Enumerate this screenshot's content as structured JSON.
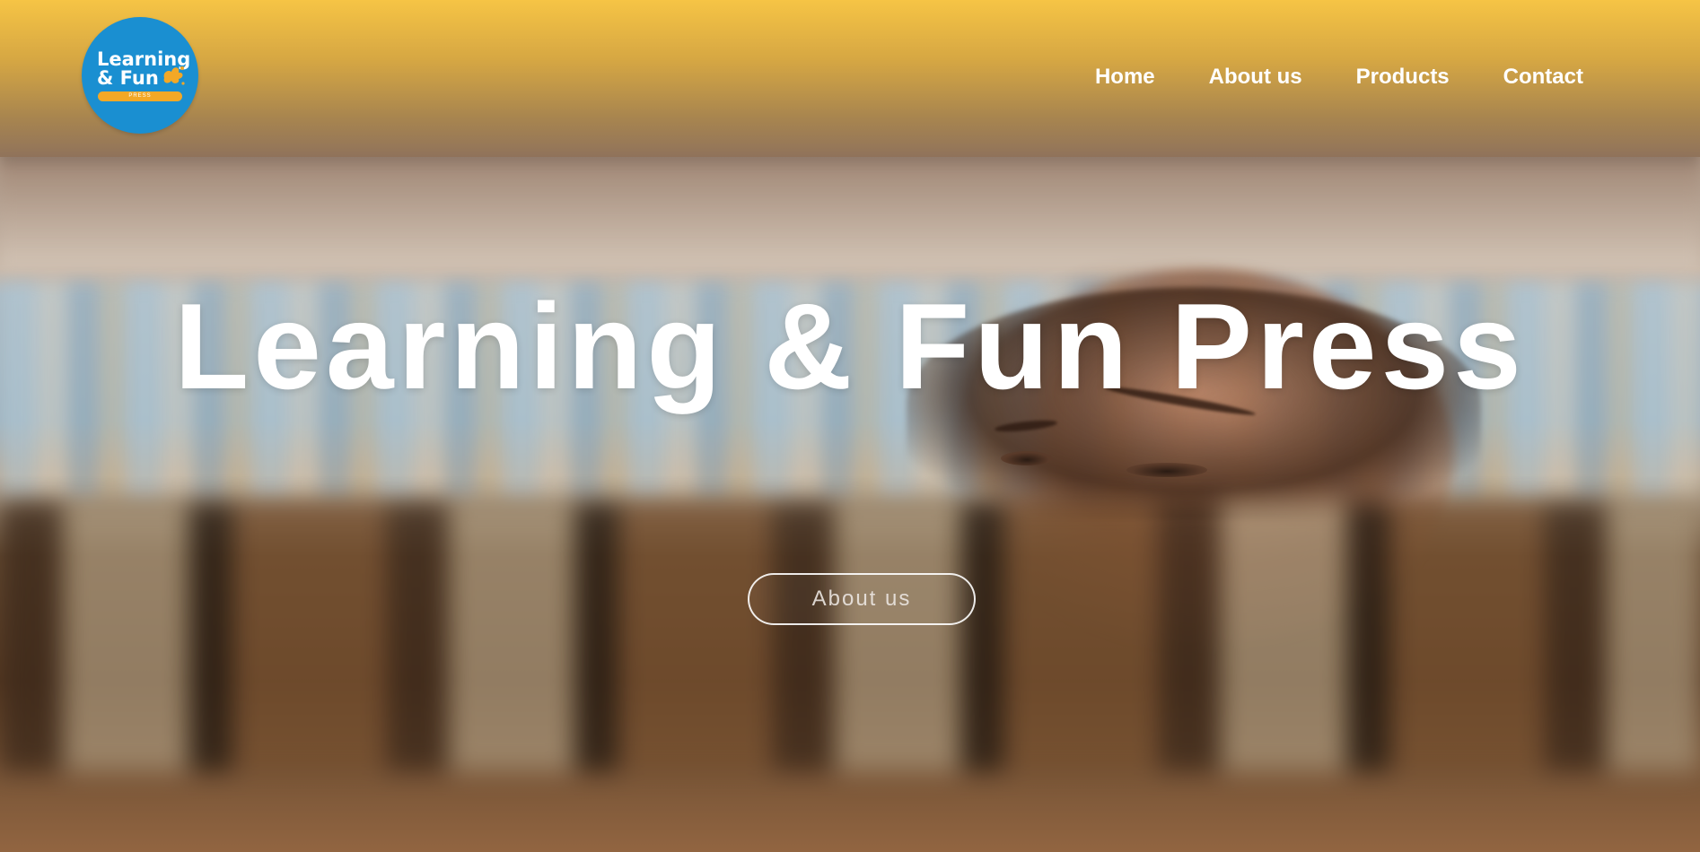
{
  "logo": {
    "line1": "Learning",
    "line2": "& Fun",
    "subtitle": "PRESS",
    "background_color": "#1a8fd1",
    "accent_color": "#f3a826"
  },
  "nav": {
    "items": [
      {
        "label": "Home"
      },
      {
        "label": "About us"
      },
      {
        "label": "Products"
      },
      {
        "label": "Contact"
      }
    ]
  },
  "hero": {
    "title": "Learning & Fun Press",
    "button_label": "About us"
  },
  "colors": {
    "header_top": "#f6c445",
    "header_bottom": "#a8854f",
    "text": "#ffffff"
  }
}
